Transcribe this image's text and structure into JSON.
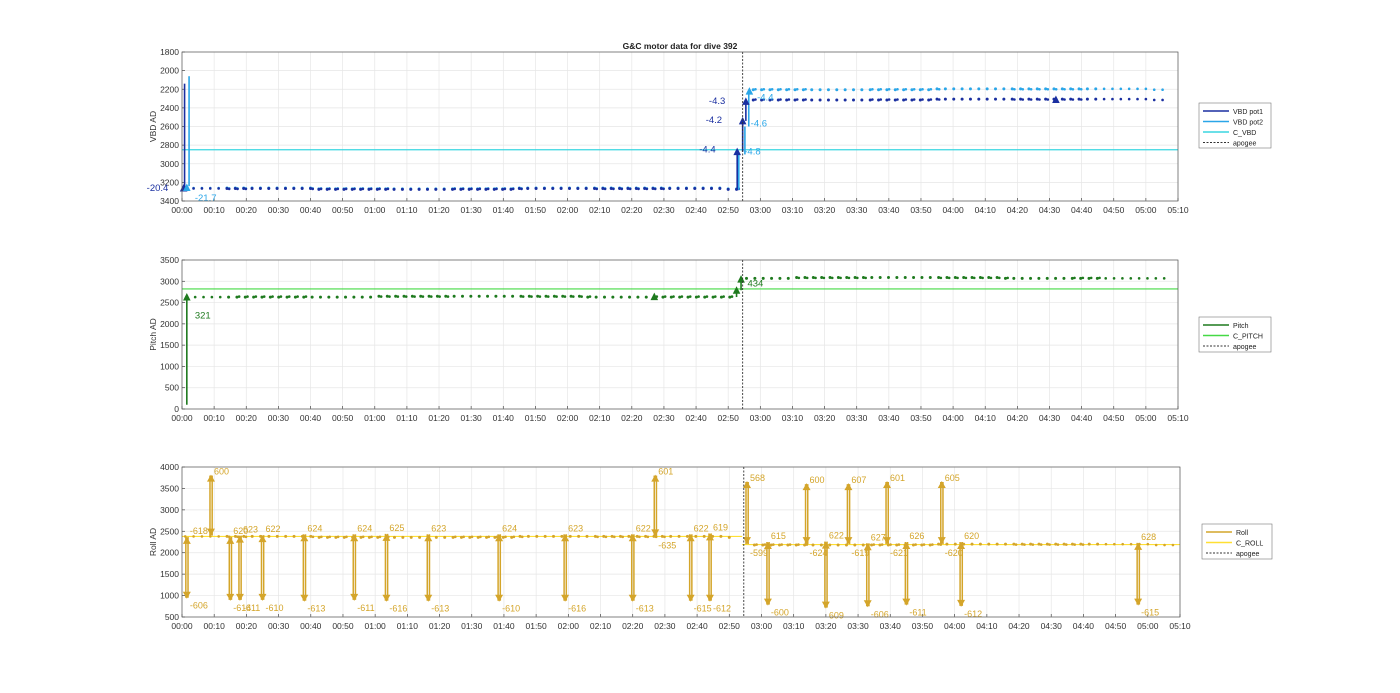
{
  "figure": {
    "title": "G&C motor data for dive 392"
  },
  "chart_data": [
    {
      "type": "scatter",
      "id": "vbd",
      "ylabel": "VBD AD",
      "ylim": [
        1800,
        3400
      ],
      "y_reversed": true,
      "yticks": [
        1800,
        2000,
        2200,
        2400,
        2600,
        2800,
        3000,
        3200,
        3400
      ],
      "xlim_min": [
        0,
        310
      ],
      "xticks": [
        "00:00",
        "00:10",
        "00:20",
        "00:30",
        "00:40",
        "00:50",
        "01:00",
        "01:10",
        "01:20",
        "01:30",
        "01:40",
        "01:50",
        "02:00",
        "02:10",
        "02:20",
        "02:30",
        "02:40",
        "02:50",
        "03:00",
        "03:10",
        "03:20",
        "03:30",
        "03:40",
        "03:50",
        "04:00",
        "04:10",
        "04:20",
        "04:30",
        "04:40",
        "04:50",
        "05:00",
        "05:10"
      ],
      "grid": true,
      "legend_position": "right",
      "legend": [
        "VBD pot1",
        "VBD pot2",
        "C_VBD",
        "apogee"
      ],
      "colors": {
        "pot1": "#1a2fa0",
        "pot2": "#2aa6e8",
        "c_line": "#3ad6e0",
        "apogee": "#333333"
      },
      "apogee_min": 174.5,
      "c_value": 2850,
      "pot1": {
        "x_start": 1,
        "x_end": 306,
        "seg1_value": 3270,
        "seg1_end": 172.8,
        "seg2_start": 175.5,
        "seg2_value": 2310
      },
      "pot2": {
        "x_start": 1,
        "x_end": 307,
        "seg1_value": 3265,
        "seg1_end": 172.8,
        "seg2_start": 176.5,
        "seg2_value": 2200
      },
      "vertical_lines": [
        {
          "series": "pot1",
          "x": 0.8,
          "y0": 3260,
          "y1": 2140
        },
        {
          "series": "pot2",
          "x": 2.2,
          "y0": 3240,
          "y1": 2060
        },
        {
          "series": "pot1",
          "x": 172.8,
          "y0": 3280,
          "y1": 2870
        },
        {
          "series": "pot2",
          "x": 173.3,
          "y0": 3280,
          "y1": 2900
        },
        {
          "series": "pot1",
          "x": 174.5,
          "y0": 2870,
          "y1": 2540
        },
        {
          "series": "pot1",
          "x": 175.5,
          "y0": 2540,
          "y1": 2330
        },
        {
          "series": "pot2",
          "x": 175.2,
          "y0": 2900,
          "y1": 2600
        },
        {
          "series": "pot2",
          "x": 176.4,
          "y0": 2600,
          "y1": 2230
        }
      ],
      "markers": [
        {
          "series": "pot1",
          "x": 0.5,
          "y": 3260
        },
        {
          "series": "pot2",
          "x": 1.5,
          "y": 3255
        },
        {
          "series": "pot1",
          "x": 172.8,
          "y": 2870
        },
        {
          "series": "pot1",
          "x": 174.5,
          "y": 2540
        },
        {
          "series": "pot1",
          "x": 175.5,
          "y": 2330
        },
        {
          "series": "pot2",
          "x": 176.6,
          "y": 2220
        },
        {
          "series": "pot1",
          "x": 272,
          "y": 2310
        }
      ],
      "annotations": [
        {
          "text": "-20.4",
          "x": -11,
          "y": 3290,
          "series": "pot1"
        },
        {
          "text": "-21.7",
          "x": 4,
          "y": 3400,
          "series": "pot2"
        },
        {
          "text": "-4.4",
          "x": 161,
          "y": 2880,
          "series": "pot1"
        },
        {
          "text": "-4.2",
          "x": 163,
          "y": 2560,
          "series": "pot1"
        },
        {
          "text": "-4.3",
          "x": 164,
          "y": 2360,
          "series": "pot1"
        },
        {
          "text": "-4.8",
          "x": 175,
          "y": 2900,
          "series": "pot2"
        },
        {
          "text": "-4.6",
          "x": 177,
          "y": 2600,
          "series": "pot2"
        },
        {
          "text": "-4.4",
          "x": 179,
          "y": 2320,
          "series": "pot2"
        }
      ]
    },
    {
      "type": "scatter",
      "id": "pitch",
      "ylabel": "Pitch AD",
      "ylim": [
        0,
        3500
      ],
      "y_reversed": false,
      "yticks": [
        0,
        500,
        1000,
        1500,
        2000,
        2500,
        3000,
        3500
      ],
      "xlim_min": [
        0,
        310
      ],
      "xticks": [
        "00:00",
        "00:10",
        "00:20",
        "00:30",
        "00:40",
        "00:50",
        "01:00",
        "01:10",
        "01:20",
        "01:30",
        "01:40",
        "01:50",
        "02:00",
        "02:10",
        "02:20",
        "02:30",
        "02:40",
        "02:50",
        "03:00",
        "03:10",
        "03:20",
        "03:30",
        "03:40",
        "03:50",
        "04:00",
        "04:10",
        "04:20",
        "04:30",
        "04:40",
        "04:50",
        "05:00",
        "05:10"
      ],
      "grid": true,
      "legend_position": "right",
      "legend": [
        "Pitch",
        "C_PITCH",
        "apogee"
      ],
      "colors": {
        "pitch": "#1e7a1e",
        "c_line": "#45d945",
        "apogee": "#333333"
      },
      "apogee_min": 174.5,
      "c_value": 2820,
      "pitch": {
        "x_start": 1.5,
        "x_end": 307,
        "seg1_value": 2640,
        "seg1_end": 172.5,
        "seg2_start": 174,
        "seg2_value": 3080
      },
      "vertical_lines": [
        {
          "series": "pitch",
          "x": 1.5,
          "y0": 100,
          "y1": 2610
        },
        {
          "series": "pitch",
          "x": 172.6,
          "y0": 2630,
          "y1": 2790
        },
        {
          "series": "pitch",
          "x": 174,
          "y0": 2790,
          "y1": 3050
        }
      ],
      "markers": [
        {
          "series": "pitch",
          "x": 1.5,
          "y": 2630
        },
        {
          "series": "pitch",
          "x": 147,
          "y": 2640
        },
        {
          "series": "pitch",
          "x": 172.6,
          "y": 2790
        },
        {
          "series": "pitch",
          "x": 174,
          "y": 3050
        }
      ],
      "annotations": [
        {
          "text": "321",
          "x": 4,
          "y": 2130,
          "series": "pitch"
        },
        {
          "text": "434",
          "x": 176,
          "y": 2880,
          "series": "pitch"
        }
      ]
    },
    {
      "type": "scatter",
      "id": "roll",
      "ylabel": "Roll AD",
      "ylim": [
        500,
        4000
      ],
      "y_reversed": false,
      "yticks": [
        500,
        1000,
        1500,
        2000,
        2500,
        3000,
        3500,
        4000
      ],
      "xlim_min": [
        0,
        310
      ],
      "xticks": [
        "00:00",
        "00:10",
        "00:20",
        "00:30",
        "00:40",
        "00:50",
        "01:00",
        "01:10",
        "01:20",
        "01:30",
        "01:40",
        "01:50",
        "02:00",
        "02:10",
        "02:20",
        "02:30",
        "02:40",
        "02:50",
        "03:00",
        "03:10",
        "03:20",
        "03:30",
        "03:40",
        "03:50",
        "04:00",
        "04:10",
        "04:20",
        "04:30",
        "04:40",
        "04:50",
        "05:00",
        "05:10"
      ],
      "grid": true,
      "legend_position": "right",
      "legend": [
        "Roll",
        "C_ROLL",
        "apogee"
      ],
      "colors": {
        "roll": "#d4a52a",
        "c_line": "#ffe033",
        "apogee": "#333333"
      },
      "apogee_min": 174.5,
      "c_levels": [
        {
          "x0": 0,
          "x1": 174,
          "y": 2380
        },
        {
          "x0": 174,
          "x1": 310,
          "y": 2190
        }
      ],
      "roll": {
        "x_start": 1,
        "x_end": 308,
        "seg1_value": 2370,
        "seg1_end": 172,
        "seg2_start": 176,
        "seg2_value": 2190
      },
      "spikes": [
        {
          "x": 1.5,
          "base": 2370,
          "peak": 950,
          "peak_label": "-606",
          "base_label": "-618"
        },
        {
          "x": 9,
          "base": 2400,
          "peak": 3800,
          "peak_label": "600",
          "base_label": ""
        },
        {
          "x": 15,
          "base": 2370,
          "peak": 900,
          "peak_label": "-614",
          "base_label": "620"
        },
        {
          "x": 18,
          "base": 2400,
          "peak": 900,
          "peak_label": "-611",
          "base_label": "623"
        },
        {
          "x": 25,
          "base": 2410,
          "peak": 900,
          "peak_label": "-610",
          "base_label": "622"
        },
        {
          "x": 38,
          "base": 2430,
          "peak": 880,
          "peak_label": "-613",
          "base_label": "624"
        },
        {
          "x": 53.5,
          "base": 2430,
          "peak": 900,
          "peak_label": "-611",
          "base_label": "624"
        },
        {
          "x": 63.5,
          "base": 2440,
          "peak": 880,
          "peak_label": "-616",
          "base_label": "625"
        },
        {
          "x": 76.5,
          "base": 2430,
          "peak": 880,
          "peak_label": "-613",
          "base_label": "623"
        },
        {
          "x": 98.5,
          "base": 2430,
          "peak": 880,
          "peak_label": "-610",
          "base_label": "624"
        },
        {
          "x": 119,
          "base": 2430,
          "peak": 880,
          "peak_label": "-616",
          "base_label": "623"
        },
        {
          "x": 140,
          "base": 2430,
          "peak": 880,
          "peak_label": "-613",
          "base_label": "622"
        },
        {
          "x": 147,
          "base": 2380,
          "peak": 3800,
          "peak_label": "601",
          "base_label": "-635"
        },
        {
          "x": 158,
          "base": 2430,
          "peak": 880,
          "peak_label": "-615",
          "base_label": "622"
        },
        {
          "x": 164,
          "base": 2450,
          "peak": 880,
          "peak_label": "-612",
          "base_label": "619"
        },
        {
          "x": 175.5,
          "base": 2200,
          "peak": 3650,
          "peak_label": "568",
          "base_label": "-599"
        },
        {
          "x": 182,
          "base": 2250,
          "peak": 790,
          "peak_label": "-600",
          "base_label": "615"
        },
        {
          "x": 194,
          "base": 2200,
          "peak": 3600,
          "peak_label": "600",
          "base_label": "-624"
        },
        {
          "x": 200,
          "base": 2260,
          "peak": 720,
          "peak_label": "609",
          "base_label": "622"
        },
        {
          "x": 207,
          "base": 2200,
          "peak": 3600,
          "peak_label": "607",
          "base_label": "-619"
        },
        {
          "x": 213,
          "base": 2220,
          "peak": 750,
          "peak_label": "-606",
          "base_label": "627"
        },
        {
          "x": 219,
          "base": 2200,
          "peak": 3650,
          "peak_label": "601",
          "base_label": "-621"
        },
        {
          "x": 225,
          "base": 2250,
          "peak": 790,
          "peak_label": "-611",
          "base_label": "626"
        },
        {
          "x": 236,
          "base": 2200,
          "peak": 3650,
          "peak_label": "605",
          "base_label": "-620"
        },
        {
          "x": 242,
          "base": 2250,
          "peak": 760,
          "peak_label": "-612",
          "base_label": "620"
        },
        {
          "x": 297,
          "base": 2230,
          "peak": 790,
          "peak_label": "-615",
          "base_label": "628"
        }
      ]
    }
  ]
}
